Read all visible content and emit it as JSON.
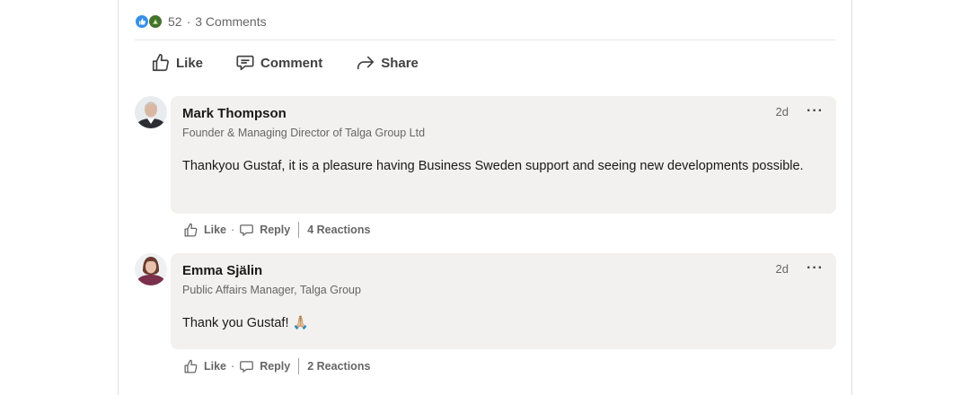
{
  "post": {
    "reaction_count": "52",
    "separator": "·",
    "comments_count": "3 Comments",
    "reaction_icons": [
      "like-icon",
      "celebrate-icon"
    ]
  },
  "actions": {
    "like": "Like",
    "comment": "Comment",
    "share": "Share"
  },
  "comments": [
    {
      "author": "Mark Thompson",
      "headline": "Founder & Managing Director of Talga Group Ltd",
      "time": "2d",
      "more": "···",
      "text": "Thankyou Gustaf, it is a pleasure having Business Sweden support and seeing new developments possible.",
      "like_label": "Like",
      "reply_label": "Reply",
      "reactions": "4 Reactions"
    },
    {
      "author": "Emma Själin",
      "headline": "Public Affairs Manager, Talga Group",
      "time": "2d",
      "more": "···",
      "text": "Thank you Gustaf! 🙏🏼",
      "like_label": "Like",
      "reply_label": "Reply",
      "reactions": "2 Reactions"
    }
  ],
  "colors": {
    "like": "#378fe9",
    "celebrate": "#44712e",
    "bubble": "#f2f1ef"
  }
}
